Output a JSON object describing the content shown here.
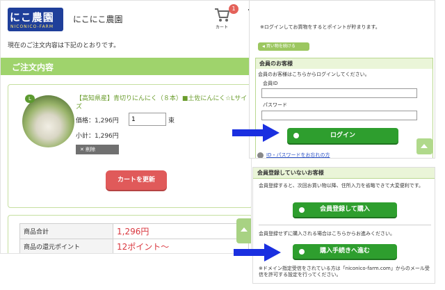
{
  "header": {
    "logo_text": "にこ農園",
    "logo_sub": "NICONICO-FARM",
    "shop_name": "にこにこ農園",
    "cart_count": "1",
    "cart_label": "カート"
  },
  "intro_text": "現在のご注文内容は下記のとおりです。",
  "section_title": "ご注文内容",
  "item": {
    "badge": "L",
    "title": "【高知県産】青切りにんにく（８本）■土佐にんにく☆Lサイズ",
    "price_label": "価格：1,296円",
    "quantity": "1",
    "unit": "束",
    "subtotal": "小計：1,296円",
    "delete_label": "✕ 削除"
  },
  "update_button": "カートを更新",
  "summary": {
    "rows": [
      {
        "label": "商品合計",
        "value": "1,296円"
      },
      {
        "label": "商品の還元ポイント",
        "value": "12ポイント〜"
      }
    ]
  },
  "login_panel": {
    "notice": "※ログインしてお買物をするとポイントが貯まります。",
    "continue_label": "買い物を続ける",
    "member_title": "会員のお客様",
    "member_text": "会員のお客様はこちらからログインしてください。",
    "id_label": "会員ID",
    "password_label": "パスワード",
    "login_button": "ログイン",
    "forgot_link": "ID・パスワードをお忘れの方"
  },
  "guest_panel": {
    "title": "会員登録していないお客様",
    "description": "会員登録すると、次回お買い物以降、住所入力を省略できて大変便利です。",
    "register_button": "会員登録して購入",
    "guest_note": "会員登録せずに購入される場合はこちらからお進みください。",
    "proceed_button": "購入手続きへ進む",
    "domain_note": "※ドメイン指定受信をされている方は「niconico-farm.com」からのメール受信を許可する設定を行ってください。"
  },
  "colors": {
    "accent_green": "#9fd36c",
    "button_green": "#2e9e2e",
    "update_red": "#e05a5a",
    "price_red": "#d9363e",
    "arrow_blue": "#1a2fe0"
  }
}
